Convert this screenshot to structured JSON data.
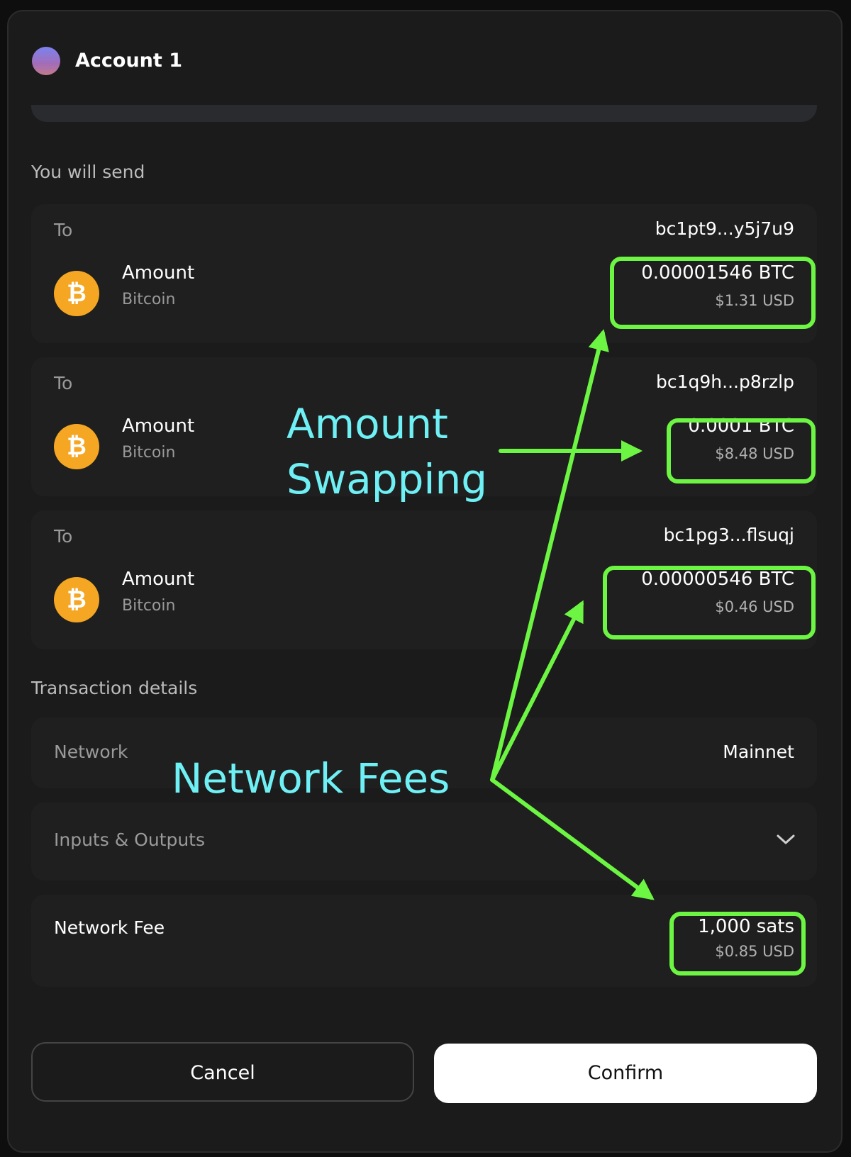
{
  "header": {
    "account_name": "Account 1"
  },
  "send": {
    "section_label": "You will send",
    "items": [
      {
        "to_label": "To",
        "address": "bc1pt9...y5j7u9",
        "asset_name": "Amount",
        "asset_sub": "Bitcoin",
        "coin_symbol": "₿",
        "amount": "0.00001546 BTC",
        "usd": "$1.31 USD"
      },
      {
        "to_label": "To",
        "address": "bc1q9h...p8rzlp",
        "asset_name": "Amount",
        "asset_sub": "Bitcoin",
        "coin_symbol": "₿",
        "amount": "0.0001 BTC",
        "usd": "$8.48 USD"
      },
      {
        "to_label": "To",
        "address": "bc1pg3...flsuqj",
        "asset_name": "Amount",
        "asset_sub": "Bitcoin",
        "coin_symbol": "₿",
        "amount": "0.00000546 BTC",
        "usd": "$0.46 USD"
      }
    ]
  },
  "details": {
    "section_label": "Transaction details",
    "network_label": "Network",
    "network_value": "Mainnet",
    "io_label": "Inputs & Outputs",
    "fee_label": "Network Fee",
    "fee_value": "1,000 sats",
    "fee_usd": "$0.85 USD"
  },
  "buttons": {
    "cancel": "Cancel",
    "confirm": "Confirm"
  },
  "annotations": {
    "amount_swapping_line1": "Amount",
    "amount_swapping_line2": "Swapping",
    "network_fees": "Network Fees",
    "highlight_color": "#6cf542",
    "text_color": "#6ef0f5"
  },
  "colors": {
    "coin": "#f5a623",
    "background": "#1b1b1b",
    "card": "#1f1f1f"
  }
}
